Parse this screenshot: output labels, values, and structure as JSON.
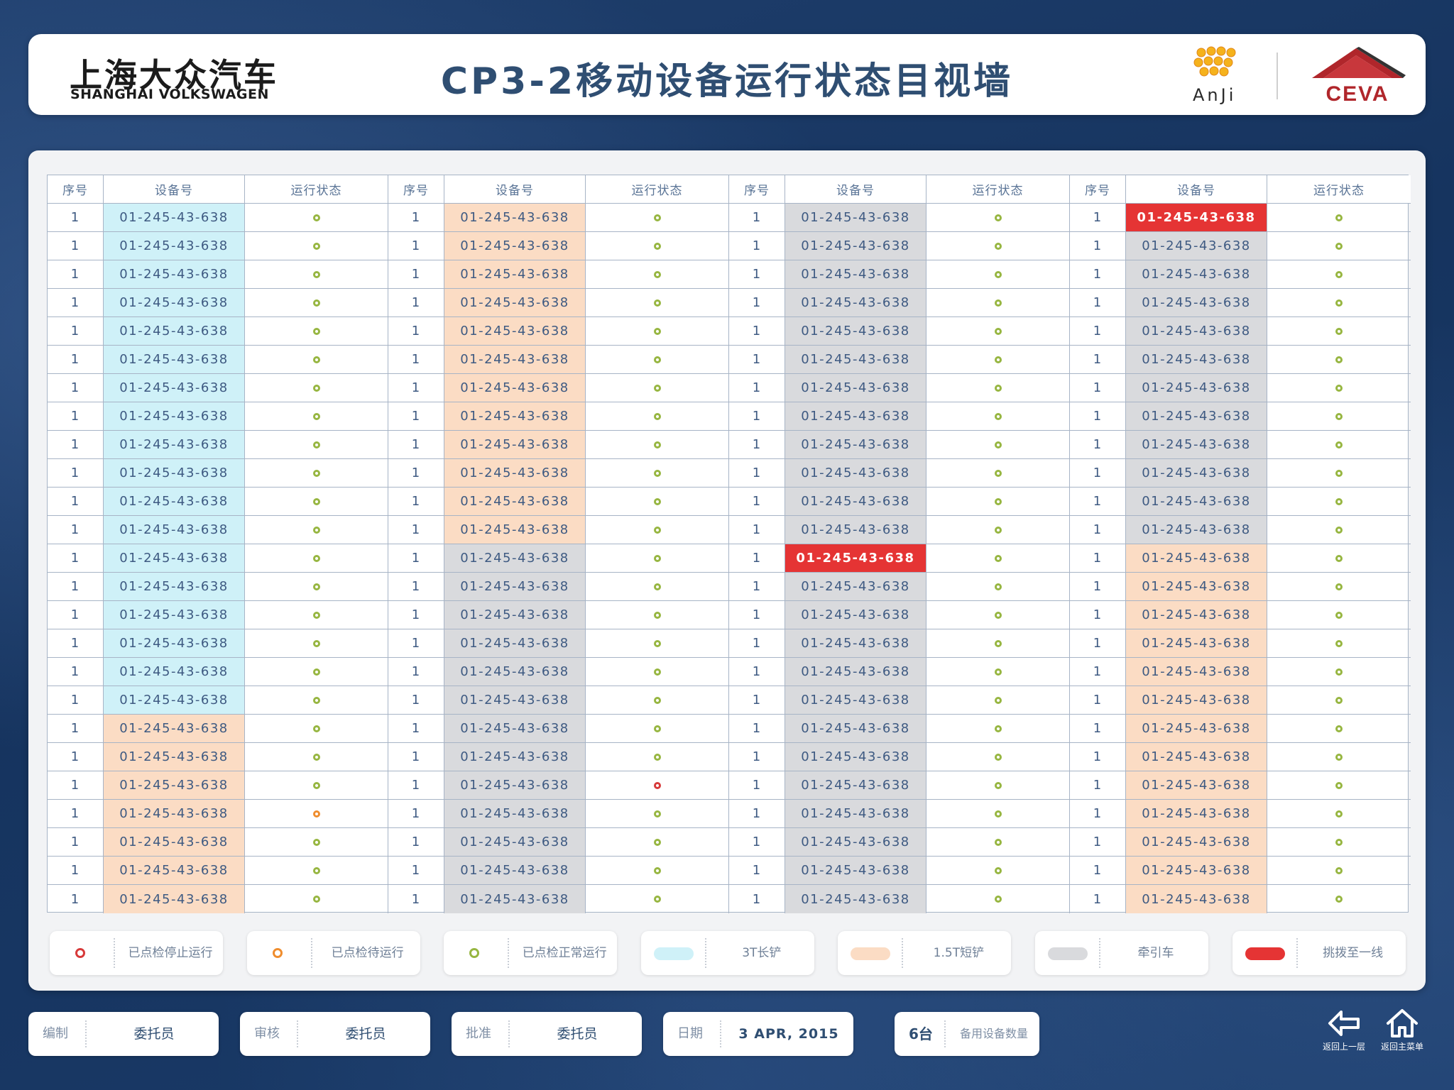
{
  "header": {
    "brand_cn": "上海大众汽车",
    "brand_en": "SHANGHAI VOLKSWAGEN",
    "title": "CP3-2移动设备运行状态目视墙",
    "partner1": "AnJi",
    "partner2": "CEVA"
  },
  "colors": {
    "blue": "#cff1f8",
    "peach": "#fbdcc4",
    "gray": "#d9dadd",
    "red": "#e53434",
    "status_ok": "#97b641",
    "status_wait": "#ef8d2e",
    "status_stop": "#d73a3a",
    "title": "#2f4e72"
  },
  "table": {
    "headers": [
      "序号",
      "设备号",
      "运行状态"
    ],
    "groups": [
      {
        "rows": [
          {
            "seq": "1",
            "device": "01-245-43-638",
            "color": "blue",
            "status": "ok"
          },
          {
            "seq": "1",
            "device": "01-245-43-638",
            "color": "blue",
            "status": "ok"
          },
          {
            "seq": "1",
            "device": "01-245-43-638",
            "color": "blue",
            "status": "ok"
          },
          {
            "seq": "1",
            "device": "01-245-43-638",
            "color": "blue",
            "status": "ok"
          },
          {
            "seq": "1",
            "device": "01-245-43-638",
            "color": "blue",
            "status": "ok"
          },
          {
            "seq": "1",
            "device": "01-245-43-638",
            "color": "blue",
            "status": "ok"
          },
          {
            "seq": "1",
            "device": "01-245-43-638",
            "color": "blue",
            "status": "ok"
          },
          {
            "seq": "1",
            "device": "01-245-43-638",
            "color": "blue",
            "status": "ok"
          },
          {
            "seq": "1",
            "device": "01-245-43-638",
            "color": "blue",
            "status": "ok"
          },
          {
            "seq": "1",
            "device": "01-245-43-638",
            "color": "blue",
            "status": "ok"
          },
          {
            "seq": "1",
            "device": "01-245-43-638",
            "color": "blue",
            "status": "ok"
          },
          {
            "seq": "1",
            "device": "01-245-43-638",
            "color": "blue",
            "status": "ok"
          },
          {
            "seq": "1",
            "device": "01-245-43-638",
            "color": "blue",
            "status": "ok"
          },
          {
            "seq": "1",
            "device": "01-245-43-638",
            "color": "blue",
            "status": "ok"
          },
          {
            "seq": "1",
            "device": "01-245-43-638",
            "color": "blue",
            "status": "ok"
          },
          {
            "seq": "1",
            "device": "01-245-43-638",
            "color": "blue",
            "status": "ok"
          },
          {
            "seq": "1",
            "device": "01-245-43-638",
            "color": "blue",
            "status": "ok"
          },
          {
            "seq": "1",
            "device": "01-245-43-638",
            "color": "blue",
            "status": "ok"
          },
          {
            "seq": "1",
            "device": "01-245-43-638",
            "color": "peach",
            "status": "ok"
          },
          {
            "seq": "1",
            "device": "01-245-43-638",
            "color": "peach",
            "status": "ok"
          },
          {
            "seq": "1",
            "device": "01-245-43-638",
            "color": "peach",
            "status": "ok"
          },
          {
            "seq": "1",
            "device": "01-245-43-638",
            "color": "peach",
            "status": "wait"
          },
          {
            "seq": "1",
            "device": "01-245-43-638",
            "color": "peach",
            "status": "ok"
          },
          {
            "seq": "1",
            "device": "01-245-43-638",
            "color": "peach",
            "status": "ok"
          },
          {
            "seq": "1",
            "device": "01-245-43-638",
            "color": "peach",
            "status": "ok"
          }
        ]
      },
      {
        "rows": [
          {
            "seq": "1",
            "device": "01-245-43-638",
            "color": "peach",
            "status": "ok"
          },
          {
            "seq": "1",
            "device": "01-245-43-638",
            "color": "peach",
            "status": "ok"
          },
          {
            "seq": "1",
            "device": "01-245-43-638",
            "color": "peach",
            "status": "ok"
          },
          {
            "seq": "1",
            "device": "01-245-43-638",
            "color": "peach",
            "status": "ok"
          },
          {
            "seq": "1",
            "device": "01-245-43-638",
            "color": "peach",
            "status": "ok"
          },
          {
            "seq": "1",
            "device": "01-245-43-638",
            "color": "peach",
            "status": "ok"
          },
          {
            "seq": "1",
            "device": "01-245-43-638",
            "color": "peach",
            "status": "ok"
          },
          {
            "seq": "1",
            "device": "01-245-43-638",
            "color": "peach",
            "status": "ok"
          },
          {
            "seq": "1",
            "device": "01-245-43-638",
            "color": "peach",
            "status": "ok"
          },
          {
            "seq": "1",
            "device": "01-245-43-638",
            "color": "peach",
            "status": "ok"
          },
          {
            "seq": "1",
            "device": "01-245-43-638",
            "color": "peach",
            "status": "ok"
          },
          {
            "seq": "1",
            "device": "01-245-43-638",
            "color": "peach",
            "status": "ok"
          },
          {
            "seq": "1",
            "device": "01-245-43-638",
            "color": "gray",
            "status": "ok"
          },
          {
            "seq": "1",
            "device": "01-245-43-638",
            "color": "gray",
            "status": "ok"
          },
          {
            "seq": "1",
            "device": "01-245-43-638",
            "color": "gray",
            "status": "ok"
          },
          {
            "seq": "1",
            "device": "01-245-43-638",
            "color": "gray",
            "status": "ok"
          },
          {
            "seq": "1",
            "device": "01-245-43-638",
            "color": "gray",
            "status": "ok"
          },
          {
            "seq": "1",
            "device": "01-245-43-638",
            "color": "gray",
            "status": "ok"
          },
          {
            "seq": "1",
            "device": "01-245-43-638",
            "color": "gray",
            "status": "ok"
          },
          {
            "seq": "1",
            "device": "01-245-43-638",
            "color": "gray",
            "status": "ok"
          },
          {
            "seq": "1",
            "device": "01-245-43-638",
            "color": "gray",
            "status": "stop"
          },
          {
            "seq": "1",
            "device": "01-245-43-638",
            "color": "gray",
            "status": "ok"
          },
          {
            "seq": "1",
            "device": "01-245-43-638",
            "color": "gray",
            "status": "ok"
          },
          {
            "seq": "1",
            "device": "01-245-43-638",
            "color": "gray",
            "status": "ok"
          },
          {
            "seq": "1",
            "device": "01-245-43-638",
            "color": "gray",
            "status": "ok"
          }
        ]
      },
      {
        "rows": [
          {
            "seq": "1",
            "device": "01-245-43-638",
            "color": "gray",
            "status": "ok"
          },
          {
            "seq": "1",
            "device": "01-245-43-638",
            "color": "gray",
            "status": "ok"
          },
          {
            "seq": "1",
            "device": "01-245-43-638",
            "color": "gray",
            "status": "ok"
          },
          {
            "seq": "1",
            "device": "01-245-43-638",
            "color": "gray",
            "status": "ok"
          },
          {
            "seq": "1",
            "device": "01-245-43-638",
            "color": "gray",
            "status": "ok"
          },
          {
            "seq": "1",
            "device": "01-245-43-638",
            "color": "gray",
            "status": "ok"
          },
          {
            "seq": "1",
            "device": "01-245-43-638",
            "color": "gray",
            "status": "ok"
          },
          {
            "seq": "1",
            "device": "01-245-43-638",
            "color": "gray",
            "status": "ok"
          },
          {
            "seq": "1",
            "device": "01-245-43-638",
            "color": "gray",
            "status": "ok"
          },
          {
            "seq": "1",
            "device": "01-245-43-638",
            "color": "gray",
            "status": "ok"
          },
          {
            "seq": "1",
            "device": "01-245-43-638",
            "color": "gray",
            "status": "ok"
          },
          {
            "seq": "1",
            "device": "01-245-43-638",
            "color": "gray",
            "status": "ok"
          },
          {
            "seq": "1",
            "device": "01-245-43-638",
            "color": "red",
            "status": "ok"
          },
          {
            "seq": "1",
            "device": "01-245-43-638",
            "color": "gray",
            "status": "ok"
          },
          {
            "seq": "1",
            "device": "01-245-43-638",
            "color": "gray",
            "status": "ok"
          },
          {
            "seq": "1",
            "device": "01-245-43-638",
            "color": "gray",
            "status": "ok"
          },
          {
            "seq": "1",
            "device": "01-245-43-638",
            "color": "gray",
            "status": "ok"
          },
          {
            "seq": "1",
            "device": "01-245-43-638",
            "color": "gray",
            "status": "ok"
          },
          {
            "seq": "1",
            "device": "01-245-43-638",
            "color": "gray",
            "status": "ok"
          },
          {
            "seq": "1",
            "device": "01-245-43-638",
            "color": "gray",
            "status": "ok"
          },
          {
            "seq": "1",
            "device": "01-245-43-638",
            "color": "gray",
            "status": "ok"
          },
          {
            "seq": "1",
            "device": "01-245-43-638",
            "color": "gray",
            "status": "ok"
          },
          {
            "seq": "1",
            "device": "01-245-43-638",
            "color": "gray",
            "status": "ok"
          },
          {
            "seq": "1",
            "device": "01-245-43-638",
            "color": "gray",
            "status": "ok"
          },
          {
            "seq": "1",
            "device": "01-245-43-638",
            "color": "gray",
            "status": "ok"
          }
        ]
      },
      {
        "rows": [
          {
            "seq": "1",
            "device": "01-245-43-638",
            "color": "red",
            "status": "ok"
          },
          {
            "seq": "1",
            "device": "01-245-43-638",
            "color": "gray",
            "status": "ok"
          },
          {
            "seq": "1",
            "device": "01-245-43-638",
            "color": "gray",
            "status": "ok"
          },
          {
            "seq": "1",
            "device": "01-245-43-638",
            "color": "gray",
            "status": "ok"
          },
          {
            "seq": "1",
            "device": "01-245-43-638",
            "color": "gray",
            "status": "ok"
          },
          {
            "seq": "1",
            "device": "01-245-43-638",
            "color": "gray",
            "status": "ok"
          },
          {
            "seq": "1",
            "device": "01-245-43-638",
            "color": "gray",
            "status": "ok"
          },
          {
            "seq": "1",
            "device": "01-245-43-638",
            "color": "gray",
            "status": "ok"
          },
          {
            "seq": "1",
            "device": "01-245-43-638",
            "color": "gray",
            "status": "ok"
          },
          {
            "seq": "1",
            "device": "01-245-43-638",
            "color": "gray",
            "status": "ok"
          },
          {
            "seq": "1",
            "device": "01-245-43-638",
            "color": "gray",
            "status": "ok"
          },
          {
            "seq": "1",
            "device": "01-245-43-638",
            "color": "gray",
            "status": "ok"
          },
          {
            "seq": "1",
            "device": "01-245-43-638",
            "color": "peach",
            "status": "ok"
          },
          {
            "seq": "1",
            "device": "01-245-43-638",
            "color": "peach",
            "status": "ok"
          },
          {
            "seq": "1",
            "device": "01-245-43-638",
            "color": "peach",
            "status": "ok"
          },
          {
            "seq": "1",
            "device": "01-245-43-638",
            "color": "peach",
            "status": "ok"
          },
          {
            "seq": "1",
            "device": "01-245-43-638",
            "color": "peach",
            "status": "ok"
          },
          {
            "seq": "1",
            "device": "01-245-43-638",
            "color": "peach",
            "status": "ok"
          },
          {
            "seq": "1",
            "device": "01-245-43-638",
            "color": "peach",
            "status": "ok"
          },
          {
            "seq": "1",
            "device": "01-245-43-638",
            "color": "peach",
            "status": "ok"
          },
          {
            "seq": "1",
            "device": "01-245-43-638",
            "color": "peach",
            "status": "ok"
          },
          {
            "seq": "1",
            "device": "01-245-43-638",
            "color": "peach",
            "status": "ok"
          },
          {
            "seq": "1",
            "device": "01-245-43-638",
            "color": "peach",
            "status": "ok"
          },
          {
            "seq": "1",
            "device": "01-245-43-638",
            "color": "peach",
            "status": "ok"
          },
          {
            "seq": "1",
            "device": "01-245-43-638",
            "color": "peach",
            "status": "ok"
          }
        ]
      }
    ]
  },
  "legend": [
    {
      "kind": "dot",
      "key": "stop",
      "label": "已点检停止运行"
    },
    {
      "kind": "dot",
      "key": "wait",
      "label": "已点检待运行"
    },
    {
      "kind": "dot",
      "key": "ok",
      "label": "已点检正常运行"
    },
    {
      "kind": "pill",
      "key": "blue",
      "label": "3T长铲"
    },
    {
      "kind": "pill",
      "key": "peach",
      "label": "1.5T短铲"
    },
    {
      "kind": "pill",
      "key": "gray",
      "label": "牵引车"
    },
    {
      "kind": "pill",
      "key": "red",
      "label": "挑拨至一线"
    }
  ],
  "footer": {
    "compiler_label": "编制",
    "compiler_value": "委托员",
    "reviewer_label": "审核",
    "reviewer_value": "委托员",
    "approver_label": "批准",
    "approver_value": "委托员",
    "date_label": "日期",
    "date_value": "3 APR, 2015",
    "spare_count": "6台",
    "spare_label": "备用设备数量",
    "back_label": "返回上一层",
    "home_label": "返回主菜单"
  }
}
